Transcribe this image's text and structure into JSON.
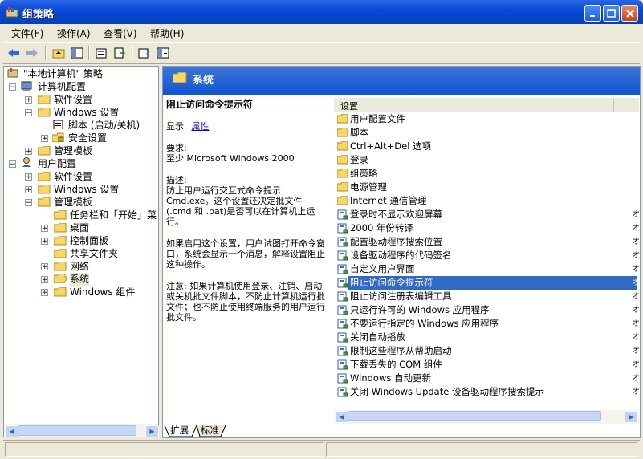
{
  "window": {
    "title": "组策略"
  },
  "menu": [
    {
      "label": "文件(F)"
    },
    {
      "label": "操作(A)"
    },
    {
      "label": "查看(V)"
    },
    {
      "label": "帮助(H)"
    }
  ],
  "tree": {
    "root": "\"本地计算机\" 策略",
    "computer_config": "计算机配置",
    "cc_software": "软件设置",
    "cc_windows": "Windows 设置",
    "cc_scripts": "脚本 (启动/关机)",
    "cc_security": "安全设置",
    "cc_admin": "管理模板",
    "user_config": "用户配置",
    "uc_software": "软件设置",
    "uc_windows": "Windows 设置",
    "uc_admin": "管理模板",
    "uc_taskbar": "任务栏和「开始」菜",
    "uc_desktop": "桌面",
    "uc_control": "控制面板",
    "uc_shared": "共享文件夹",
    "uc_network": "网络",
    "uc_system": "系统",
    "uc_components": "Windows 组件"
  },
  "header": {
    "title": "系统"
  },
  "description": {
    "title": "阻止访问命令提示符",
    "show_label": "显示",
    "show_link": "属性",
    "req_label": "要求:",
    "req_text": "至少 Microsoft Windows 2000",
    "desc_label": "描述:",
    "desc_text": "防止用户运行交互式命令提示 Cmd.exe。这个设置还决定批文件 (.cmd 和 .bat)是否可以在计算机上运行。",
    "desc_text2": "如果启用这个设置，用户试图打开命令窗口，系统会显示一个消息，解释设置阻止这种操作。",
    "note_text": "注意: 如果计算机使用登录、注销、启动或关机批文件脚本，不防止计算机运行批文件；也不防止使用终端服务的用户运行批文件。"
  },
  "list": {
    "column": "设置",
    "items": [
      {
        "label": "用户配置文件",
        "type": "folder"
      },
      {
        "label": "脚本",
        "type": "folder"
      },
      {
        "label": "Ctrl+Alt+Del 选项",
        "type": "folder"
      },
      {
        "label": "登录",
        "type": "folder"
      },
      {
        "label": "组策略",
        "type": "folder"
      },
      {
        "label": "电源管理",
        "type": "folder"
      },
      {
        "label": "Internet 通信管理",
        "type": "folder"
      },
      {
        "label": "登录时不显示欢迎屏幕",
        "type": "setting"
      },
      {
        "label": "2000 年份转译",
        "type": "setting"
      },
      {
        "label": "配置驱动程序搜索位置",
        "type": "setting"
      },
      {
        "label": "设备驱动程序的代码签名",
        "type": "setting"
      },
      {
        "label": "自定义用户界面",
        "type": "setting"
      },
      {
        "label": "阻止访问命令提示符",
        "type": "setting"
      },
      {
        "label": "阻止访问注册表编辑工具",
        "type": "setting"
      },
      {
        "label": "只运行许可的 Windows 应用程序",
        "type": "setting"
      },
      {
        "label": "不要运行指定的 Windows 应用程序",
        "type": "setting"
      },
      {
        "label": "关闭自动播放",
        "type": "setting"
      },
      {
        "label": "限制这些程序从帮助启动",
        "type": "setting"
      },
      {
        "label": "下载丢失的 COM 组件",
        "type": "setting"
      },
      {
        "label": "Windows 自动更新",
        "type": "setting"
      },
      {
        "label": "关闭 Windows Update 设备驱动程序搜索提示",
        "type": "setting"
      }
    ],
    "truncated_marker": "オ"
  },
  "tabs": {
    "extended": "扩展",
    "standard": "标准"
  },
  "colors": {
    "title_blue": "#0a4ad8",
    "selection": "#316ac5",
    "folder": "#f7d66a"
  }
}
